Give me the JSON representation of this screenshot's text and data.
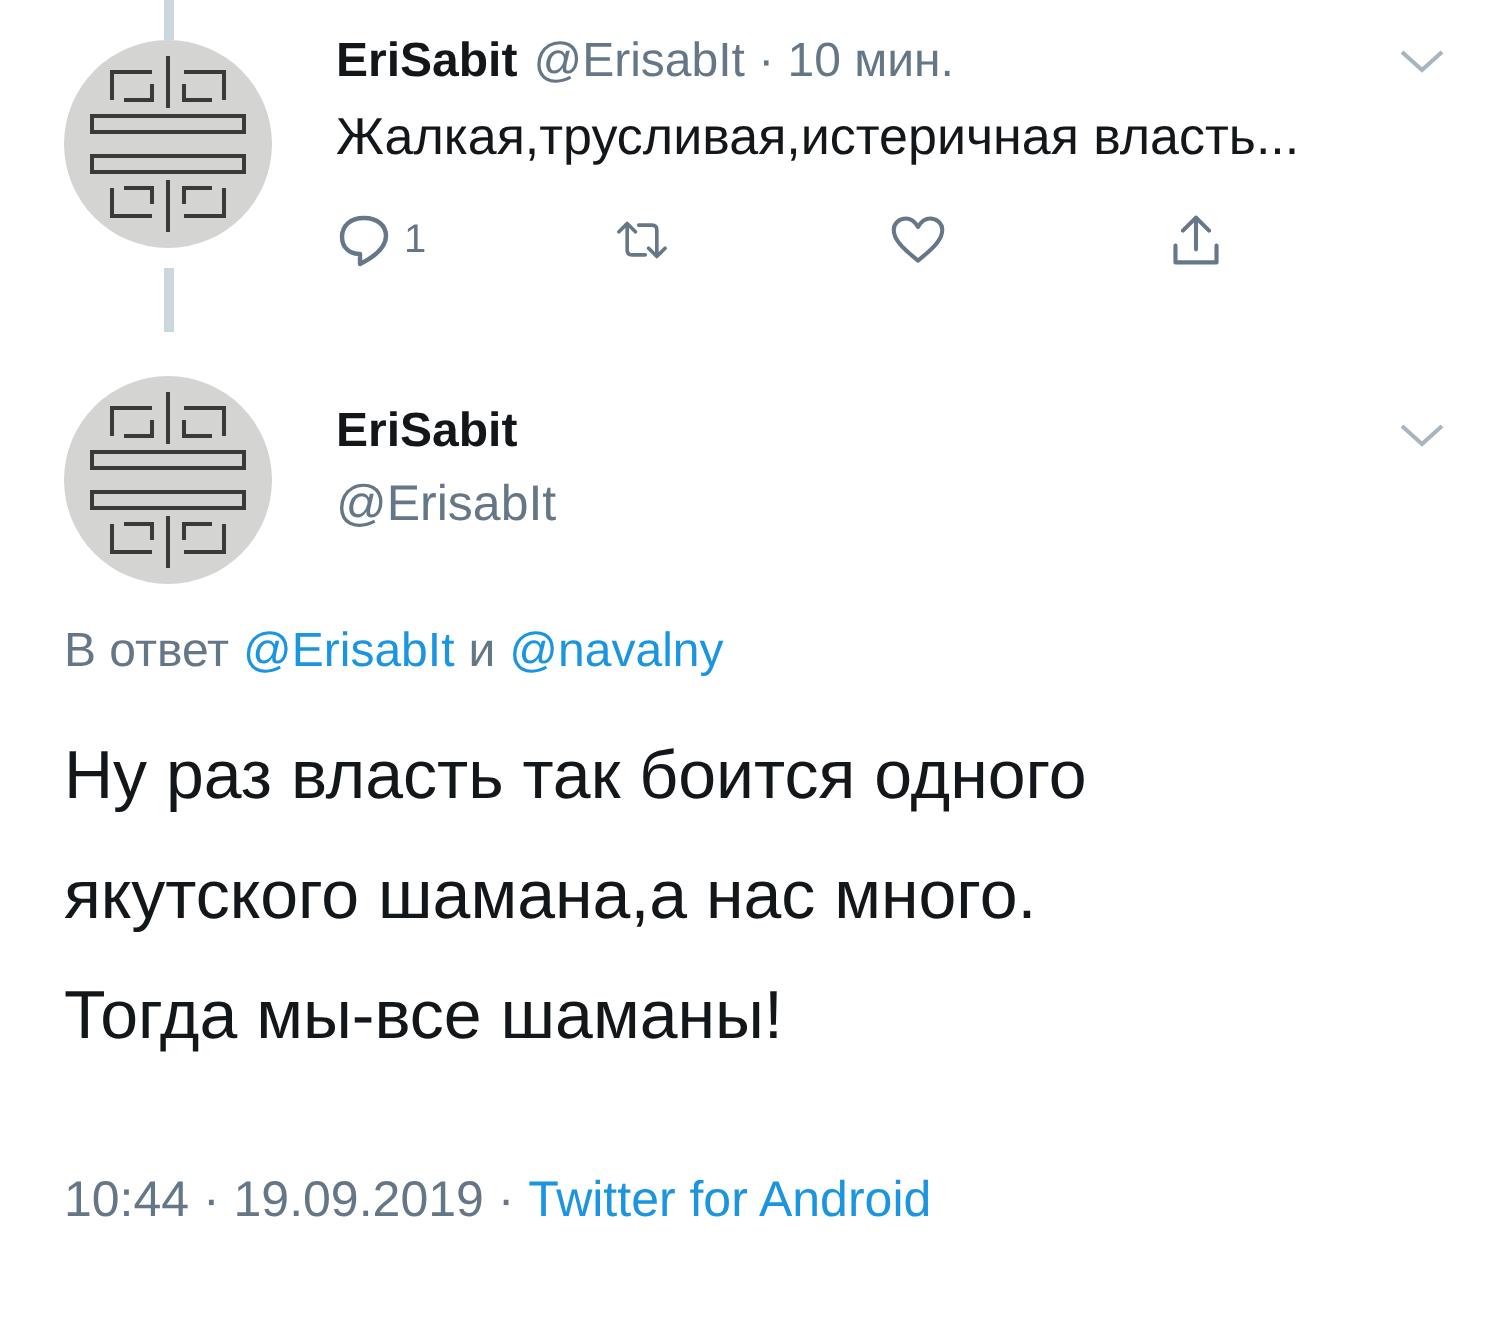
{
  "tweets": [
    {
      "kind": "parent",
      "name": "EriSabit",
      "handle": "@ErisabIt",
      "separator": "·",
      "time": "10 мин.",
      "text": "Жалкая,трусливая,истеричная власть...",
      "reply_count": "1"
    },
    {
      "kind": "main",
      "name": "EriSabit",
      "handle": "@ErisabIt",
      "reply_prefix": "В ответ",
      "mentions": [
        "@ErisabIt",
        "@navalny"
      ],
      "conjunction": "и",
      "lines": [
        "Ну раз власть так боится одного",
        "якутского шамана,а нас много.",
        "Тогда мы-все шаманы!"
      ],
      "timestamp": "10:44 · 19.09.2019 ·",
      "source": "Twitter for Android"
    }
  ]
}
